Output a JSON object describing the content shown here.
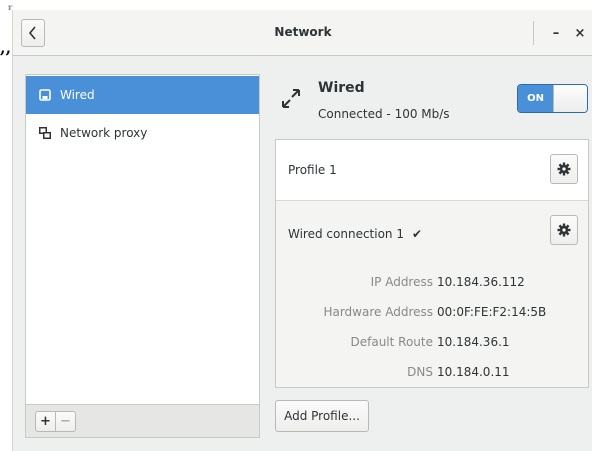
{
  "headerbar": {
    "title": "Network",
    "back_icon": "chevron-left-icon",
    "minimize_label": "–",
    "close_label": "×"
  },
  "stray": {
    "quote": ",,"
  },
  "sidebar": {
    "items": [
      {
        "label": "Wired",
        "icon": "wired-device-icon",
        "selected": true
      },
      {
        "label": "Network proxy",
        "icon": "network-proxy-icon",
        "selected": false
      }
    ],
    "add_label": "+",
    "remove_label": "−"
  },
  "device": {
    "title": "Wired",
    "status": "Connected - 100 Mb/s",
    "toggle_label": "ON",
    "toggle_on": true,
    "icon": "wired-connection-arrows-icon"
  },
  "profiles": [
    {
      "name": "Profile 1"
    },
    {
      "name": "Wired connection 1",
      "active": true
    }
  ],
  "details": [
    {
      "key": "IP Address",
      "value": "10.184.36.112"
    },
    {
      "key": "Hardware Address",
      "value": "00:0F:FE:F2:14:5B"
    },
    {
      "key": "Default Route",
      "value": "10.184.36.1"
    },
    {
      "key": "DNS",
      "value": "10.184.0.11"
    }
  ],
  "add_profile_label": "Add Profile...",
  "colors": {
    "accent": "#4a90d9",
    "window_bg": "#eef0ef",
    "text": "#2e3436",
    "dim_text": "#888a85"
  }
}
